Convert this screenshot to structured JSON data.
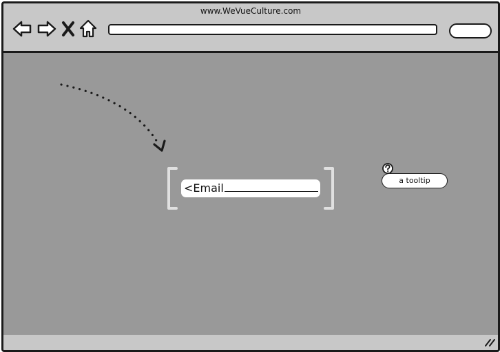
{
  "browser": {
    "title": "www.WeVueCulture.com",
    "address_value": "",
    "search_value": "",
    "nav": {
      "back_icon": "arrow-left-icon",
      "forward_icon": "arrow-right-icon",
      "stop_icon": "close-icon",
      "home_icon": "home-icon",
      "search_icon": "search-icon"
    }
  },
  "content": {
    "email_field": {
      "prefix": "<",
      "label": "Email"
    },
    "help_icon": "question-icon",
    "tooltip_text": "a tooltip"
  },
  "colors": {
    "chrome": "#c8c8c8",
    "content_bg": "#999999",
    "bracket": "#e0e0e0",
    "outline": "#1a1a1a"
  }
}
